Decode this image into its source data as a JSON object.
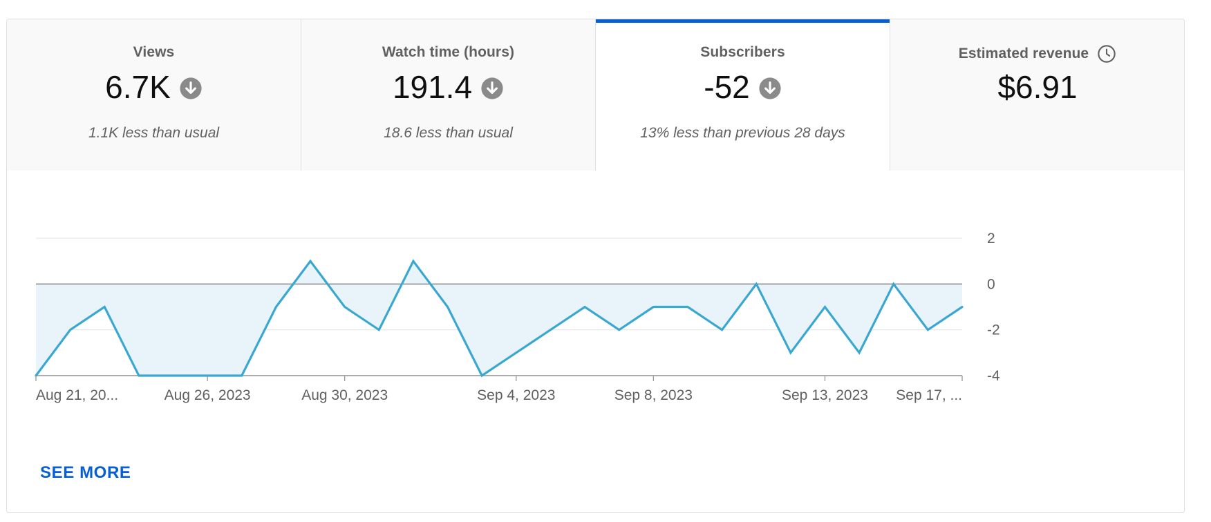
{
  "metrics": [
    {
      "title": "Views",
      "value": "6.7K",
      "trend_icon": "arrow-down-circle-icon",
      "comparison": "1.1K less than usual"
    },
    {
      "title": "Watch time (hours)",
      "value": "191.4",
      "trend_icon": "arrow-down-circle-icon",
      "comparison": "18.6 less than usual"
    },
    {
      "title": "Subscribers",
      "value": "-52",
      "trend_icon": "arrow-down-circle-icon",
      "comparison": "13% less than previous 28 days"
    },
    {
      "title": "Estimated revenue",
      "value": "$6.91",
      "info_icon": "clock-icon",
      "comparison": ""
    }
  ],
  "active_tab": "Subscribers",
  "accent_color": "#065fd4",
  "line_color": "#3aa7d0",
  "fill_color": "#e8f4fa",
  "see_more_label": "SEE MORE",
  "chart_data": {
    "type": "area",
    "series": [
      {
        "values": [
          -4,
          -2,
          -1,
          -4,
          -4,
          -4,
          -4,
          -1,
          1,
          -1,
          -2,
          1,
          -1,
          -4,
          -3,
          -2,
          -1,
          -2,
          -1,
          -1,
          -2,
          0,
          -3,
          -1,
          -3,
          0,
          -2,
          -1
        ]
      }
    ],
    "x_tick_labels": [
      "Aug 21, 20...",
      "Aug 26, 2023",
      "Aug 30, 2023",
      "Sep 4, 2023",
      "Sep 8, 2023",
      "Sep 13, 2023",
      "Sep 17, ..."
    ],
    "x_tick_indices": [
      0,
      5,
      9,
      14,
      18,
      23,
      27
    ],
    "y_ticks": [
      2,
      0,
      -2,
      -4
    ],
    "ylim": [
      -4,
      2
    ],
    "y_axis_position": "right",
    "grid": true
  }
}
